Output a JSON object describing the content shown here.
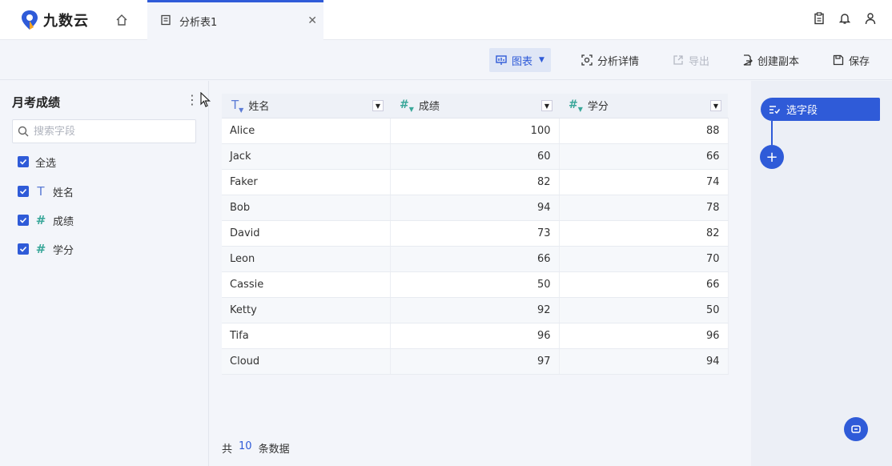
{
  "app": {
    "name": "九数云"
  },
  "tabs": [
    {
      "label": "分析表1"
    }
  ],
  "toolbar": {
    "chart_label": "图表",
    "analysis_detail_label": "分析详情",
    "export_label": "导出",
    "copy_label": "创建副本",
    "save_label": "保存"
  },
  "left_panel": {
    "title": "月考成绩",
    "search_placeholder": "搜索字段",
    "select_all_label": "全选",
    "fields": [
      {
        "label": "姓名",
        "type_icon": "T"
      },
      {
        "label": "成绩",
        "type_icon": "#"
      },
      {
        "label": "学分",
        "type_icon": "#"
      }
    ]
  },
  "table": {
    "columns": [
      {
        "label": "姓名",
        "type": "text",
        "type_icon": "T"
      },
      {
        "label": "成绩",
        "type": "number",
        "type_icon": "#"
      },
      {
        "label": "学分",
        "type": "number",
        "type_icon": "#"
      }
    ],
    "rows": [
      [
        "Alice",
        "100",
        "88"
      ],
      [
        "Jack",
        "60",
        "66"
      ],
      [
        "Faker",
        "82",
        "74"
      ],
      [
        "Bob",
        "94",
        "78"
      ],
      [
        "David",
        "73",
        "82"
      ],
      [
        "Leon",
        "66",
        "70"
      ],
      [
        "Cassie",
        "50",
        "66"
      ],
      [
        "Ketty",
        "92",
        "50"
      ],
      [
        "Tifa",
        "96",
        "96"
      ],
      [
        "Cloud",
        "97",
        "94"
      ]
    ]
  },
  "footer": {
    "prefix": "共",
    "count": "10",
    "suffix": "条数据"
  },
  "right_panel": {
    "step_label": "选字段",
    "add_symbol": "+"
  },
  "colors": {
    "accent": "#2f5bd8",
    "number_icon": "#3aa79a",
    "text_icon": "#5b7bd5"
  }
}
